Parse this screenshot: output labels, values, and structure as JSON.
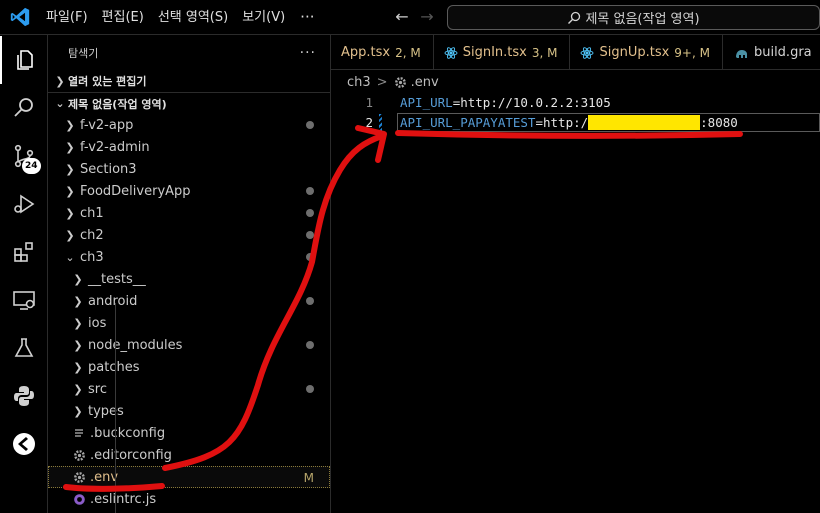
{
  "menu": [
    "파일(F)",
    "편집(E)",
    "선택 영역(S)",
    "보기(V)"
  ],
  "menu_more": "···",
  "search": {
    "text": "제목 없음(작업 영역)"
  },
  "activity": {
    "source_control_badge": "24"
  },
  "sidebar": {
    "title": "탐색기",
    "more": "···",
    "open_editors": "열려 있는 편집기",
    "workspace": "제목 없음(작업 영역)",
    "items": [
      {
        "label": "f-v2-app",
        "dot": true
      },
      {
        "label": "f-v2-admin"
      },
      {
        "label": "Section3"
      },
      {
        "label": "FoodDeliveryApp",
        "dot": true
      },
      {
        "label": "ch1",
        "dot": true
      },
      {
        "label": "ch2",
        "dot": true
      },
      {
        "label": "ch3",
        "dot": true
      },
      {
        "label": "__tests__"
      },
      {
        "label": "android",
        "dot": true
      },
      {
        "label": "ios"
      },
      {
        "label": "node_modules",
        "dot": true
      },
      {
        "label": "patches"
      },
      {
        "label": "src",
        "dot": true
      },
      {
        "label": "types"
      },
      {
        "label": ".buckconfig"
      },
      {
        "label": ".editorconfig"
      },
      {
        "label": ".env",
        "status": "M"
      },
      {
        "label": ".eslintrc.js"
      }
    ]
  },
  "tabs": [
    {
      "name": "App.tsx",
      "status": "2, M"
    },
    {
      "name": "SignIn.tsx",
      "status": "3, M"
    },
    {
      "name": "SignUp.tsx",
      "status": "9+, M"
    },
    {
      "name": "build.gra"
    }
  ],
  "breadcrumb": {
    "folder": "ch3",
    "sep": ">",
    "file": ".env"
  },
  "editor": {
    "lines": [
      {
        "num": "1",
        "key": "API_URL",
        "eq": "=",
        "value": "http://10.0.2.2:3105"
      },
      {
        "num": "2",
        "key": "API_URL_PAPAYATEST",
        "eq": "=",
        "value_prefix": "http:/",
        "value_suffix": ":8080"
      }
    ]
  },
  "colors": {
    "annotation": "#e01010",
    "redaction": "#ffe600",
    "accent": "#569cd6"
  }
}
